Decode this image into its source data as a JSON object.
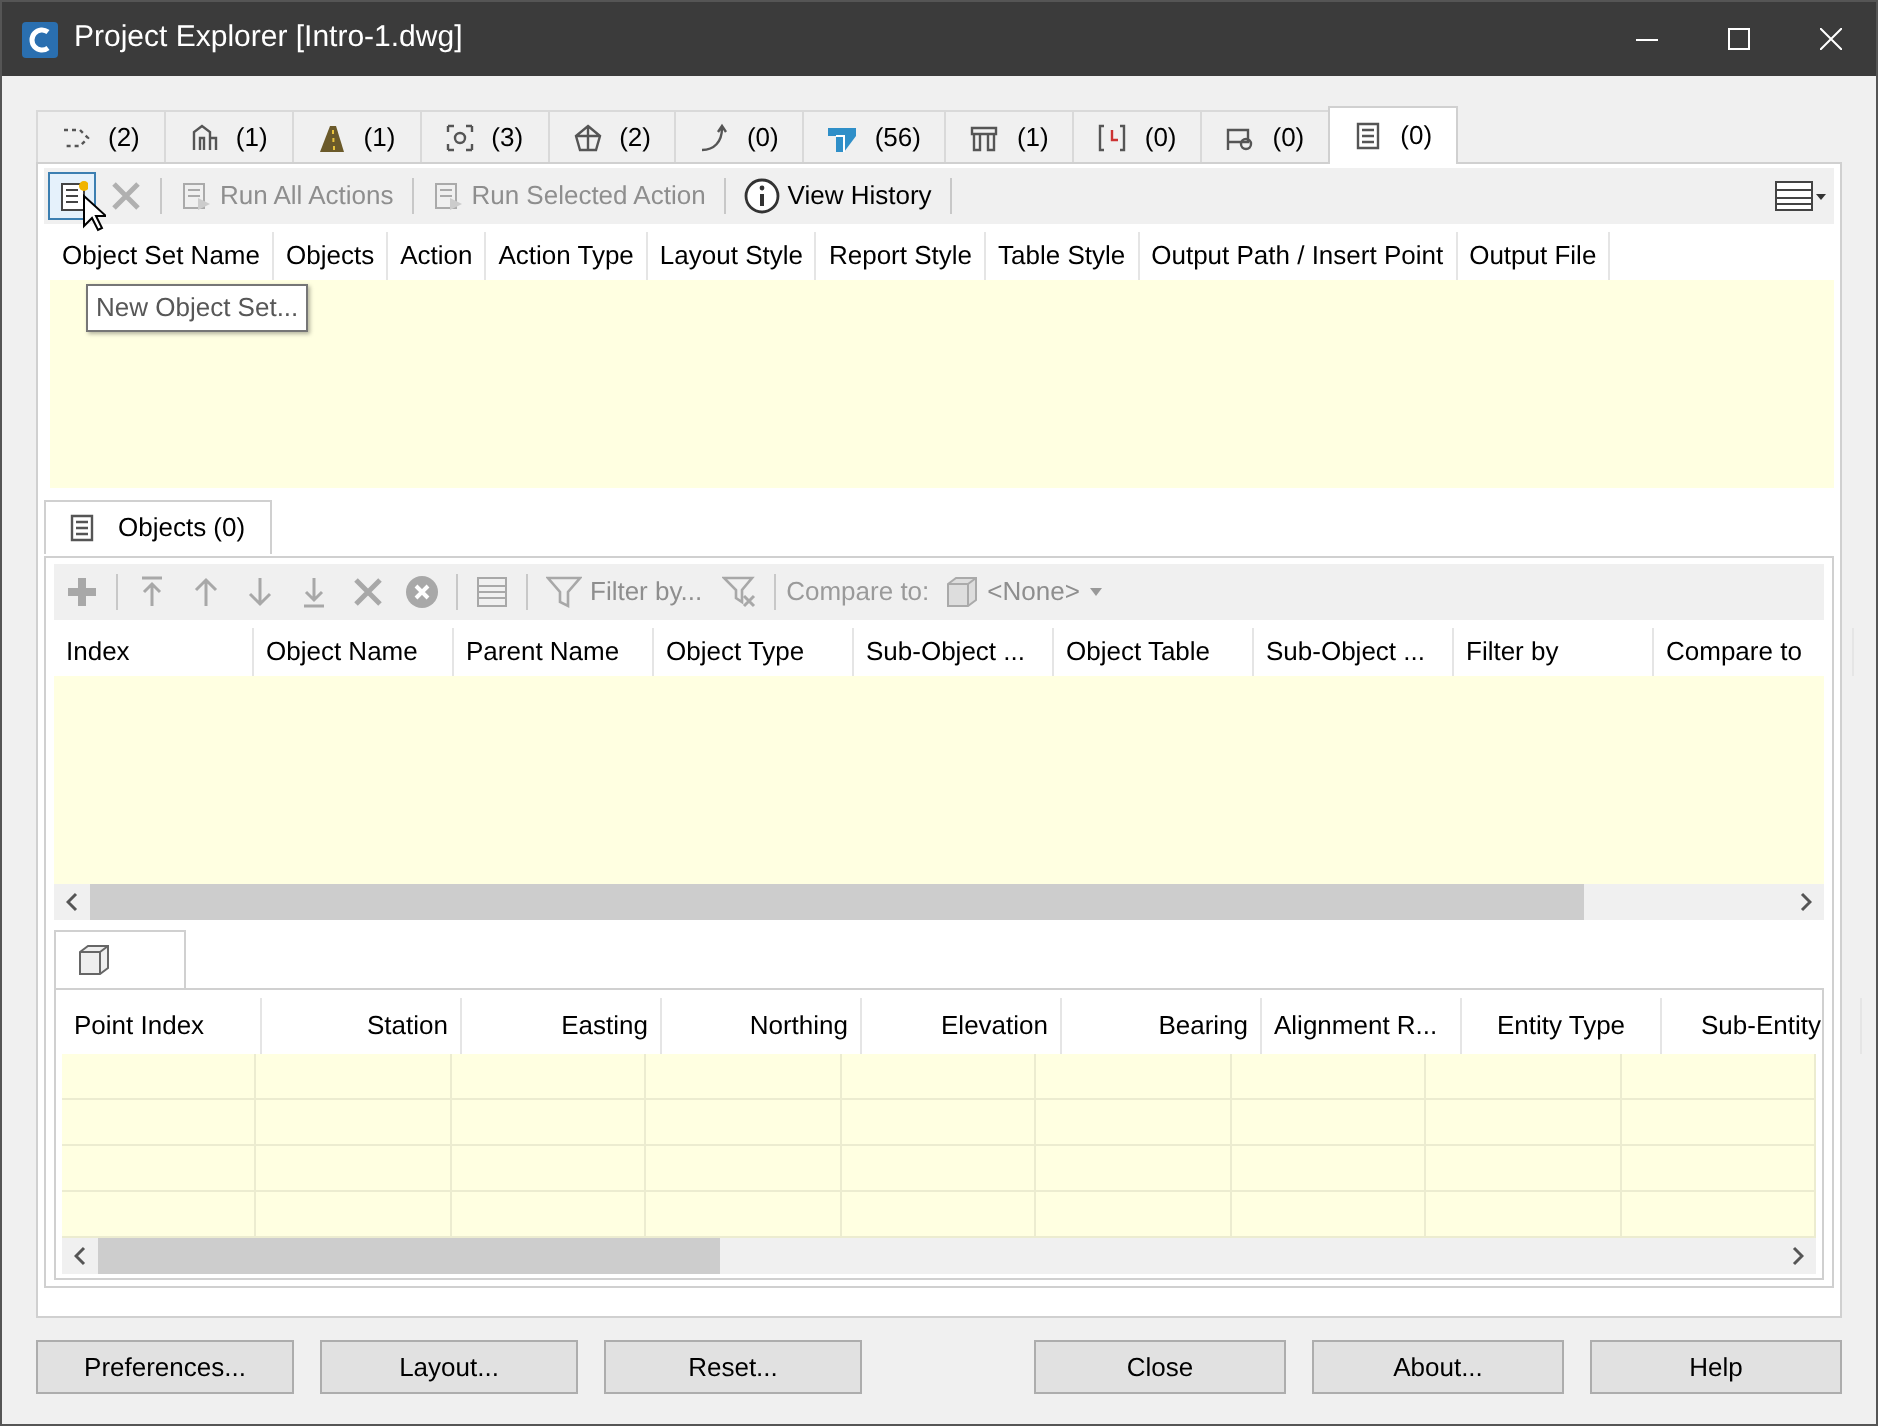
{
  "window": {
    "title": "Project Explorer [Intro-1.dwg]"
  },
  "tabs": [
    {
      "count": "(2)",
      "selected": false
    },
    {
      "count": "(1)",
      "selected": false
    },
    {
      "count": "(1)",
      "selected": false
    },
    {
      "count": "(3)",
      "selected": false
    },
    {
      "count": "(2)",
      "selected": false
    },
    {
      "count": "(0)",
      "selected": false
    },
    {
      "count": "(56)",
      "selected": false
    },
    {
      "count": "(1)",
      "selected": false
    },
    {
      "count": "(0)",
      "selected": false
    },
    {
      "count": "(0)",
      "selected": false
    },
    {
      "count": "(0)",
      "selected": true
    }
  ],
  "toolbar": [
    {
      "kind": "icon",
      "disabled": false,
      "hovered": true
    },
    {
      "kind": "icon",
      "disabled": true,
      "hovered": false
    },
    {
      "kind": "separator"
    },
    {
      "kind": "button",
      "label": "Run All Actions",
      "disabled": true,
      "hovered": false
    },
    {
      "kind": "separator"
    },
    {
      "kind": "button",
      "label": "Run Selected Action",
      "disabled": true,
      "hovered": false
    },
    {
      "kind": "separator"
    },
    {
      "kind": "button",
      "label": "View History",
      "disabled": false,
      "hovered": false
    },
    {
      "kind": "separator"
    }
  ],
  "tooltip": "New Object Set...",
  "sets_table": {
    "columns": [
      "Object Set Name",
      "Objects",
      "Action",
      "Action Type",
      "Layout Style",
      "Report Style",
      "Table Style",
      "Output Path / Insert Point",
      "Output File"
    ]
  },
  "objects_tab": {
    "label": "Objects (0)",
    "selected": true
  },
  "objects_toolbar": {
    "disabled": true,
    "filter_label": "Filter by...",
    "compare_label": "Compare to:",
    "compare_value": "<None>"
  },
  "objects_table": {
    "columns": [
      "Index",
      "Object Name",
      "Parent Name",
      "Object Type",
      "Sub-Object ...",
      "Object Table",
      "Sub-Object ...",
      "Filter by",
      "Compare to"
    ]
  },
  "points_tab": {
    "selected": true
  },
  "points_table": {
    "columns": [
      {
        "label": "Point Index",
        "right_aligned": false,
        "centered": false
      },
      {
        "label": "Station",
        "right_aligned": true,
        "centered": false
      },
      {
        "label": "Easting",
        "right_aligned": true,
        "centered": false
      },
      {
        "label": "Northing",
        "right_aligned": true,
        "centered": false
      },
      {
        "label": "Elevation",
        "right_aligned": true,
        "centered": false
      },
      {
        "label": "Bearing",
        "right_aligned": true,
        "centered": false
      },
      {
        "label": "Alignment R...",
        "right_aligned": false,
        "centered": false
      },
      {
        "label": "Entity Type",
        "right_aligned": false,
        "centered": true
      },
      {
        "label": "Sub-Entity",
        "right_aligned": false,
        "centered": true
      }
    ]
  },
  "buttons_left": [
    "Preferences...",
    "Layout...",
    "Reset..."
  ],
  "buttons_right": [
    "Close",
    "About...",
    "Help"
  ]
}
